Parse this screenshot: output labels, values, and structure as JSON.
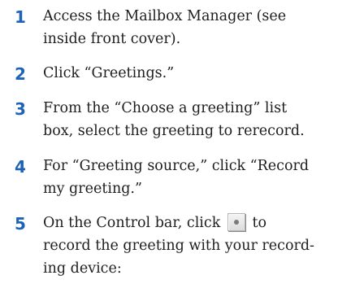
{
  "steps": [
    {
      "number": "1",
      "lines": [
        "Access the Mailbox Manager (see",
        "inside front cover)."
      ]
    },
    {
      "number": "2",
      "lines": [
        "Click “Greetings.”"
      ]
    },
    {
      "number": "3",
      "lines": [
        "From the “Choose a greeting” list",
        "box, select the greeting to rerecord."
      ]
    },
    {
      "number": "4",
      "lines": [
        "For “Greeting source,” click “Record",
        "my greeting.”"
      ]
    },
    {
      "number": "5",
      "line1_before": "On the Control bar, click",
      "line1_after": "to",
      "button_icon": "record-icon",
      "lines_rest": [
        "record the greeting with your record-",
        "ing device:"
      ]
    }
  ]
}
